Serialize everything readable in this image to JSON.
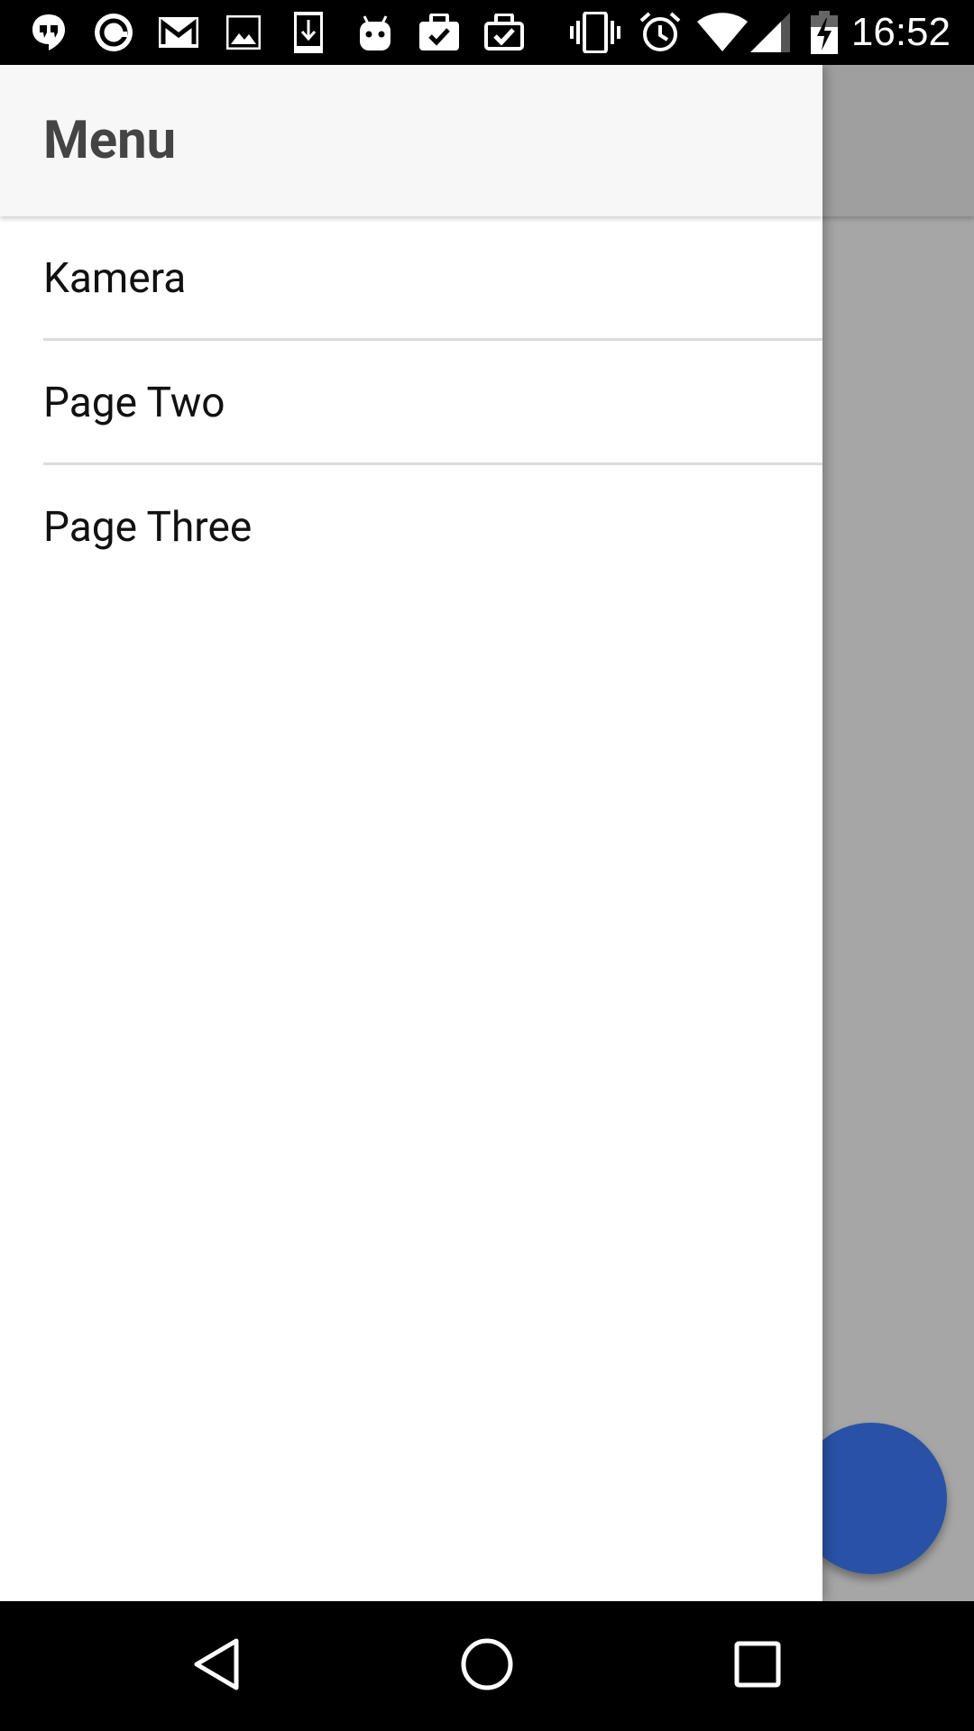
{
  "status_bar": {
    "time": "16:52",
    "left_icons": [
      "hangouts-icon",
      "circle-app-icon",
      "gmail-icon",
      "gallery-icon",
      "download-icon",
      "android-icon",
      "work-check-icon",
      "work-check-outline-icon"
    ],
    "right_icons": [
      "vibrate-icon",
      "alarm-icon",
      "wifi-icon",
      "signal-icon",
      "battery-charging-icon"
    ]
  },
  "drawer": {
    "title": "Menu",
    "items": [
      {
        "label": "Kamera"
      },
      {
        "label": "Page Two"
      },
      {
        "label": "Page Three"
      }
    ]
  },
  "nav_bar": {
    "buttons": [
      "back-icon",
      "home-icon",
      "recents-icon"
    ]
  },
  "colors": {
    "fab": "#3f7fff",
    "drawer_header_bg": "#f7f7f7",
    "title_text": "#444444",
    "scrim": "rgba(0,0,0,0.35)"
  }
}
